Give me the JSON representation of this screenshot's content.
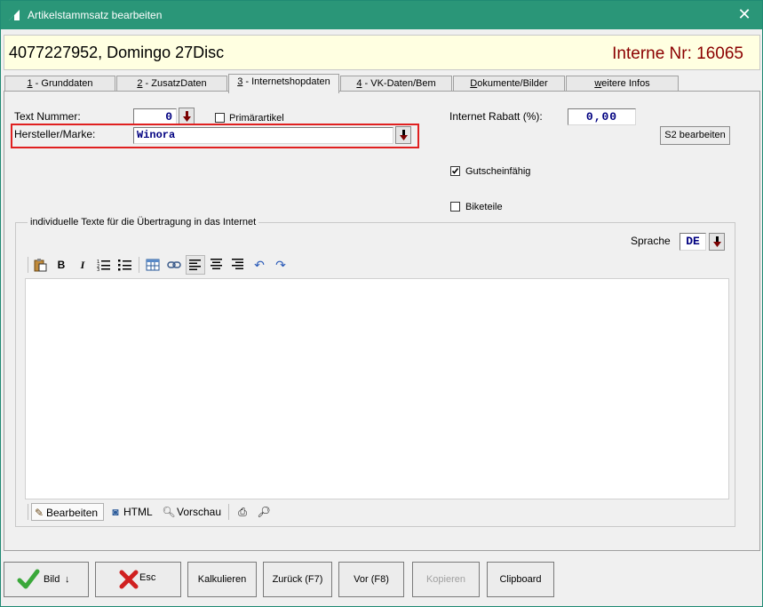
{
  "window": {
    "title": "Artikelstammsatz bearbeiten",
    "close_glyph": "✕"
  },
  "header": {
    "article": "4077227952, Domingo 27Disc",
    "interne": "Interne Nr: 16065"
  },
  "tabs": [
    {
      "key": "1",
      "label": " - Grunddaten"
    },
    {
      "key": "2",
      "label": " - ZusatzDaten"
    },
    {
      "key": "3",
      "label": " - Internetshopdaten"
    },
    {
      "key": "4",
      "label": " - VK-Daten/Bem"
    },
    {
      "key": "D",
      "label": "okumente/Bilder"
    },
    {
      "key": "w",
      "label": "eitere Infos"
    }
  ],
  "form": {
    "text_nummer_label": "Text Nummer:",
    "text_nummer_value": "0",
    "primaerartikel_label": "Primärartikel",
    "hersteller_label": "Hersteller/Marke:",
    "hersteller_value": "Winora",
    "rabatt_label": "Internet Rabatt (%):",
    "rabatt_value": "0,00",
    "s2_button": "S2 bearbeiten",
    "gutschein_label": "Gutscheinfähig",
    "gutschein_checked": true,
    "biketeile_label": "Biketeile",
    "biketeile_checked": false
  },
  "texts": {
    "legend": "individuelle Texte für die Übertragung in das Internet",
    "sprache_label": "Sprache",
    "sprache_value": "DE",
    "editor_toolbar": [
      "paste-icon",
      "bold-icon",
      "italic-icon",
      "ordered-list-icon",
      "bullet-list-icon",
      "table-icon",
      "link-icon",
      "align-left-icon",
      "align-center-icon",
      "align-right-icon",
      "undo-icon",
      "redo-icon"
    ],
    "modes": {
      "edit": "Bearbeiten",
      "html": "HTML",
      "preview": "Vorschau"
    }
  },
  "footer": {
    "bild": "Bild",
    "esc": "Esc",
    "kalkulieren": "Kalkulieren",
    "zurueck": "Zurück (F7)",
    "vor": "Vor (F8)",
    "kopieren": "Kopieren",
    "clipboard": "Clipboard"
  },
  "colors": {
    "titlebar": "#2a9678",
    "header_bg": "#ffffe1",
    "interne": "#8b0000",
    "highlight": "#e02020",
    "value_blue": "#000080"
  }
}
